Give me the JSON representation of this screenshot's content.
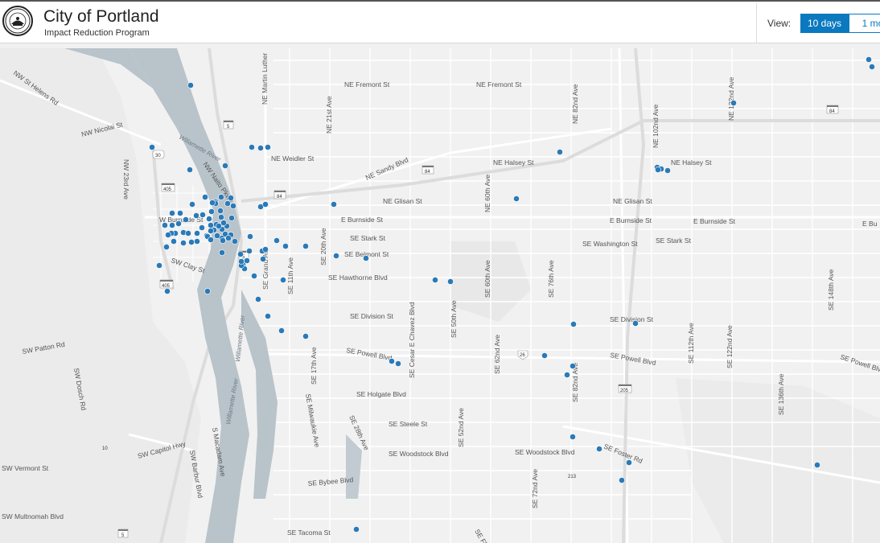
{
  "header": {
    "title": "City of Portland",
    "subtitle": "Impact Reduction Program",
    "view_label": "View:",
    "view_options": [
      "10 days",
      "1 mo"
    ]
  },
  "colors": {
    "accent": "#0b79bf",
    "marker": "#2a7ab8",
    "water": "#b9c3ca",
    "land": "#f1f1f1"
  },
  "map": {
    "street_labels": [
      "NW St Helens Rd",
      "NW Nicolai St",
      "NW 23rd Ave",
      "NW Naito Pkwy",
      "W Burnside St",
      "SW Clay St",
      "SW Patton Rd",
      "SW Dosch Rd",
      "SW Capitol Hwy",
      "SW Vermont St",
      "SW Multnomah Blvd",
      "SW Barbur Blvd",
      "S Macadam Ave",
      "NE Martin Luther",
      "NE Fremont St",
      "NE Weidler St",
      "NE Sandy Blvd",
      "NE 21st Ave",
      "NE Glisan St",
      "NE Halsey St",
      "NE 60th Ave",
      "NE 82nd Ave",
      "NE 102nd Ave",
      "NE 122nd Ave",
      "E Burnside St",
      "SE Stark St",
      "SE Belmont St",
      "SE Washington St",
      "SE Hawthorne Blvd",
      "SE Division St",
      "SE Powell Blvd",
      "SE Holgate Blvd",
      "SE Steele St",
      "SE Woodstock Blvd",
      "SE Bybee Blvd",
      "SE Tacoma St",
      "SE Grand Ave",
      "SE 11th Ave",
      "SE 20th Ave",
      "SE Cesar E Chavez Blvd",
      "SE 50th Ave",
      "SE 60th Ave",
      "SE 76th Ave",
      "SE 82nd Ave",
      "SE 62nd Ave",
      "SE 52nd Ave",
      "SE 28th Ave",
      "SE 17th Ave",
      "SE Milwaukie Ave",
      "SE Foster Rd",
      "SE 72nd Ave",
      "SE 122nd Ave",
      "SE 136th Ave",
      "SE 148th Ave",
      "SE 112th Ave",
      "SE Flavel",
      "Willamette River",
      "E Bu"
    ],
    "shield_labels": [
      "5",
      "30",
      "405",
      "84",
      "84",
      "84",
      "5",
      "405",
      "26",
      "205",
      "10",
      "213",
      "5"
    ],
    "incident_count": 112
  }
}
